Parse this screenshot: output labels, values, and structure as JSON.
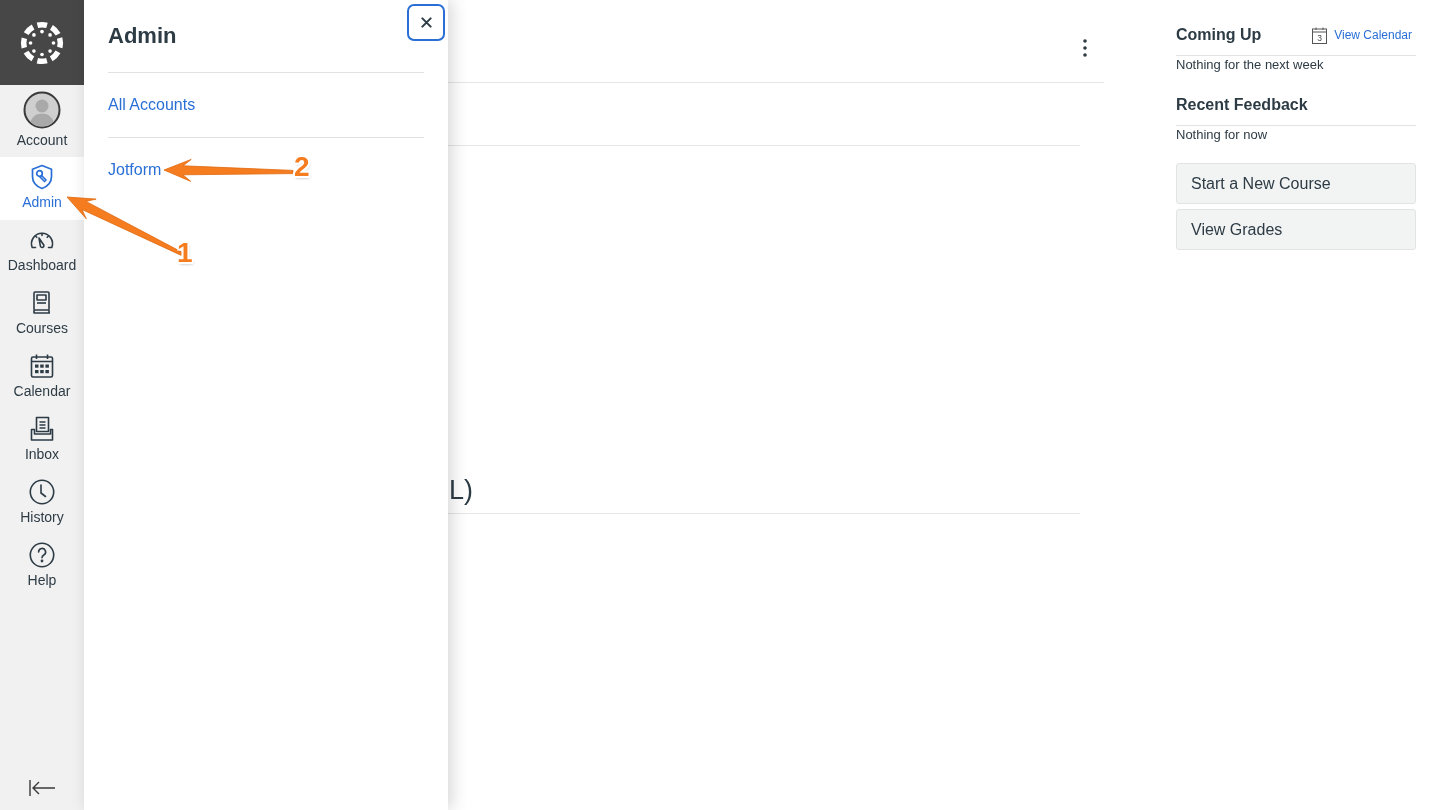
{
  "global_nav": {
    "items": [
      {
        "label": "Account",
        "selected": false
      },
      {
        "label": "Admin",
        "selected": true
      },
      {
        "label": "Dashboard",
        "selected": false
      },
      {
        "label": "Courses",
        "selected": false
      },
      {
        "label": "Calendar",
        "selected": false
      },
      {
        "label": "Inbox",
        "selected": false
      },
      {
        "label": "History",
        "selected": false
      },
      {
        "label": "Help",
        "selected": false
      }
    ]
  },
  "tray": {
    "title": "Admin",
    "links": [
      {
        "label": "All Accounts"
      },
      {
        "label": "Jotform"
      }
    ]
  },
  "main": {
    "text_fragment": "L)"
  },
  "sidebar": {
    "coming_up": {
      "title": "Coming Up",
      "calendar_day": "3",
      "link": "View Calendar",
      "empty_text": "Nothing for the next week"
    },
    "recent_feedback": {
      "title": "Recent Feedback",
      "empty_text": "Nothing for now"
    },
    "buttons": [
      "Start a New Course",
      "View Grades"
    ]
  },
  "annotations": [
    {
      "number": "1"
    },
    {
      "number": "2"
    }
  ]
}
